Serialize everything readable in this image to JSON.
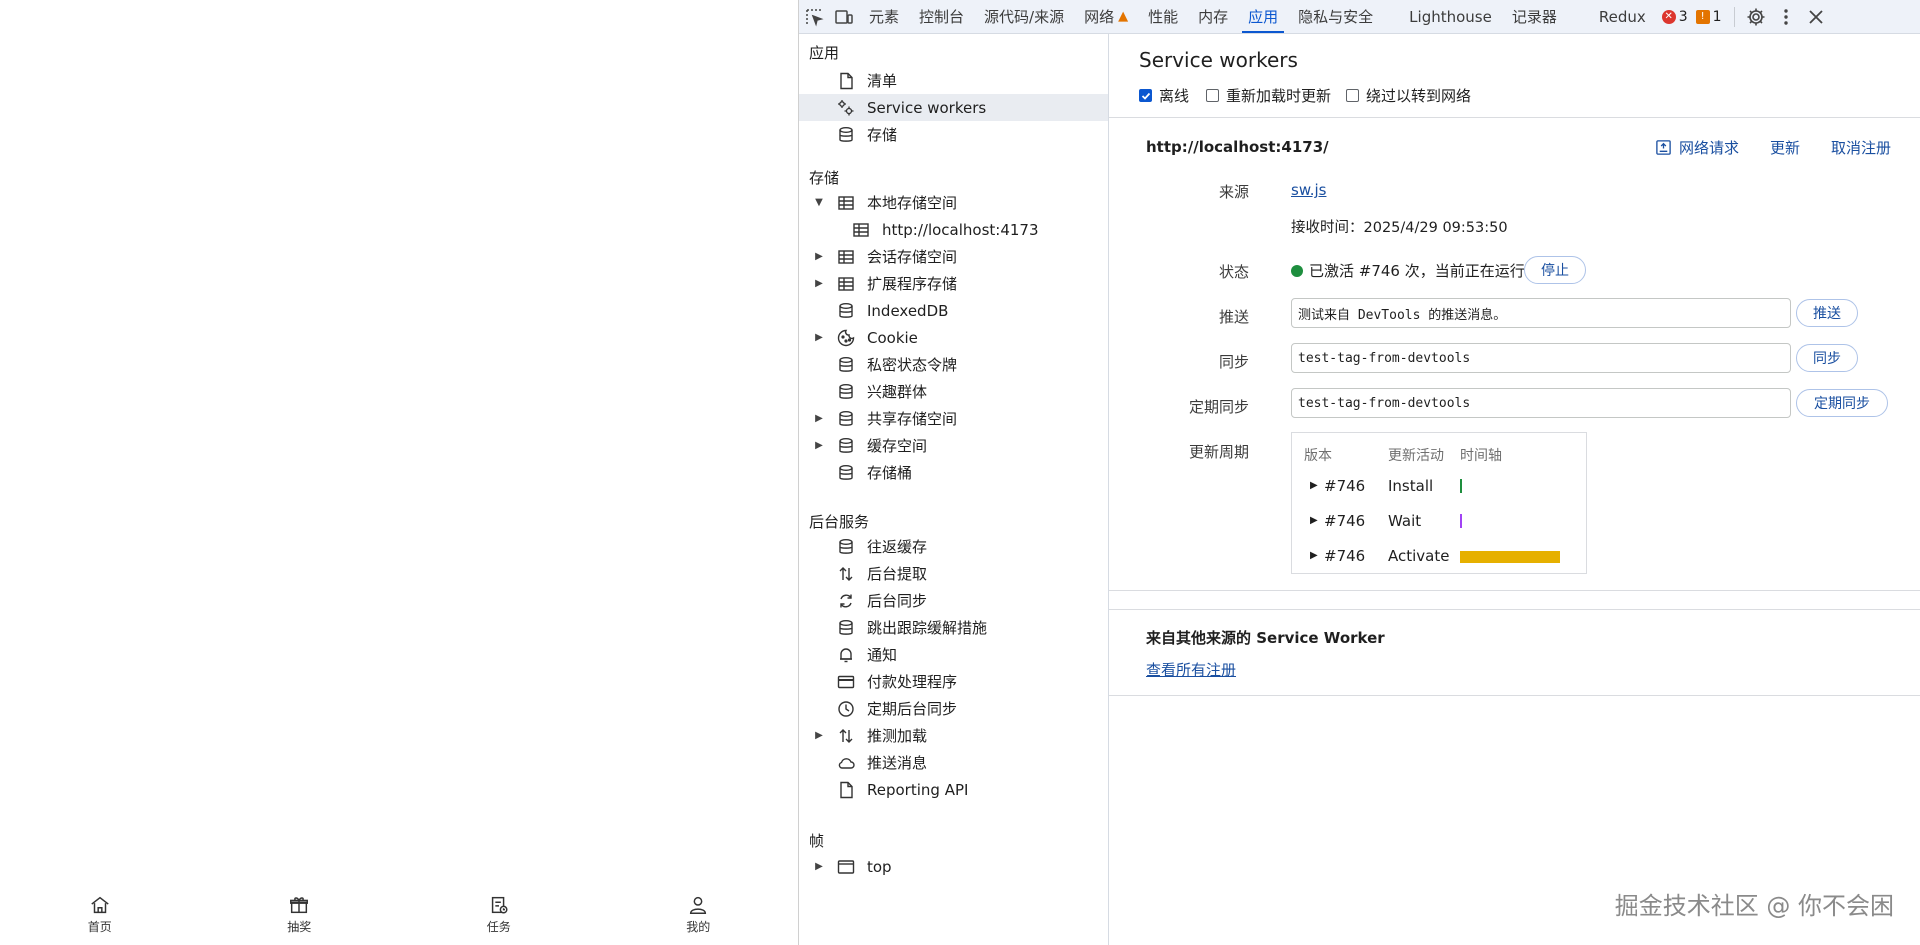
{
  "app": {
    "nav": [
      {
        "label": "首页",
        "icon": "home-icon"
      },
      {
        "label": "抽奖",
        "icon": "gift-icon"
      },
      {
        "label": "任务",
        "icon": "task-icon"
      },
      {
        "label": "我的",
        "icon": "user-icon"
      }
    ]
  },
  "toolbar": {
    "tabs": [
      "元素",
      "控制台",
      "源代码/来源",
      "网络",
      "性能",
      "内存",
      "应用",
      "隐私与安全",
      "Lighthouse",
      "记录器",
      "Redux"
    ],
    "active_tab": "应用",
    "errors": "3",
    "warnings": "1"
  },
  "sidebar": {
    "sections": {
      "app": "应用",
      "storage": "存储",
      "background": "后台服务",
      "frames": "帧"
    },
    "app_items": [
      "清单",
      "Service workers",
      "存储"
    ],
    "storage_items": [
      "本地存储空间",
      "http://localhost:4173",
      "会话存储空间",
      "扩展程序存储",
      "IndexedDB",
      "Cookie",
      "私密状态令牌",
      "兴趣群体",
      "共享存储空间",
      "缓存空间",
      "存储桶"
    ],
    "background_items": [
      "往返缓存",
      "后台提取",
      "后台同步",
      "跳出跟踪缓解措施",
      "通知",
      "付款处理程序",
      "定期后台同步",
      "推测加载",
      "推送消息",
      "Reporting API"
    ],
    "frame_items": [
      "top"
    ]
  },
  "main": {
    "title": "Service workers",
    "options": {
      "offline": "离线",
      "reload_update": "重新加载时更新",
      "bypass_network": "绕过以转到网络"
    },
    "origin": "http://localhost:4173/",
    "actions": {
      "network_requests": "网络请求",
      "update": "更新",
      "unregister": "取消注册"
    },
    "labels": {
      "source": "来源",
      "status": "状态",
      "push": "推送",
      "sync": "同步",
      "periodic_sync": "定期同步",
      "update_cycle": "更新周期"
    },
    "source_link": "sw.js",
    "received": "接收时间：2025/4/29 09:53:50",
    "status_text": "已激活 #746 次，当前正在运行",
    "stop_button": "停止",
    "push_value": "测试来自 DevTools 的推送消息。",
    "push_button": "推送",
    "sync_value": "test-tag-from-devtools",
    "sync_button": "同步",
    "periodic_value": "test-tag-from-devtools",
    "periodic_button": "定期同步",
    "cycle_headers": {
      "version": "版本",
      "activity": "更新活动",
      "timeline": "时间轴"
    },
    "cycle_rows": [
      {
        "version": "#746",
        "activity": "Install",
        "color": "#1e8e3e"
      },
      {
        "version": "#746",
        "activity": "Wait",
        "color": "#a142f4"
      },
      {
        "version": "#746",
        "activity": "Activate",
        "color": "#e6b000"
      }
    ],
    "other_title": "来自其他来源的 Service Worker",
    "view_all": "查看所有注册"
  },
  "watermark": "掘金技术社区 @ 你不会困"
}
